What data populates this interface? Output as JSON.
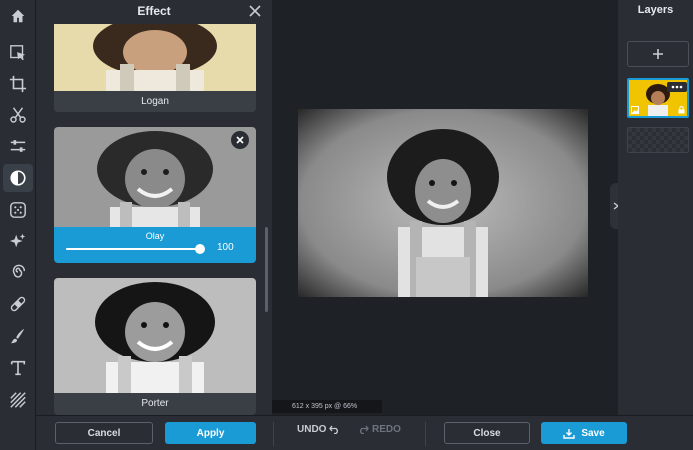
{
  "panel": {
    "title": "Effect"
  },
  "effects": [
    {
      "label": "Logan"
    },
    {
      "label": "Olay",
      "intensity": 100
    },
    {
      "label": "Porter"
    }
  ],
  "canvas": {
    "dimensions": "612 x 395 px @ 66%"
  },
  "layers": {
    "title": "Layers"
  },
  "actions": {
    "cancel": "Cancel",
    "apply": "Apply",
    "undo": "UNDO",
    "redo": "REDO",
    "close": "Close",
    "save": "Save"
  },
  "icons": {
    "toolbar": [
      "home-icon",
      "select-icon",
      "crop-icon",
      "cut-icon",
      "adjust-icon",
      "effect-icon",
      "filter-icon",
      "sparkle-icon",
      "swirl-icon",
      "bandage-icon",
      "brush-icon",
      "text-icon",
      "texture-icon"
    ]
  },
  "colors": {
    "accent": "#1a9bd6",
    "panel": "#2a2e34",
    "canvas": "#1e2126",
    "layer_bg": "#f0c400"
  }
}
